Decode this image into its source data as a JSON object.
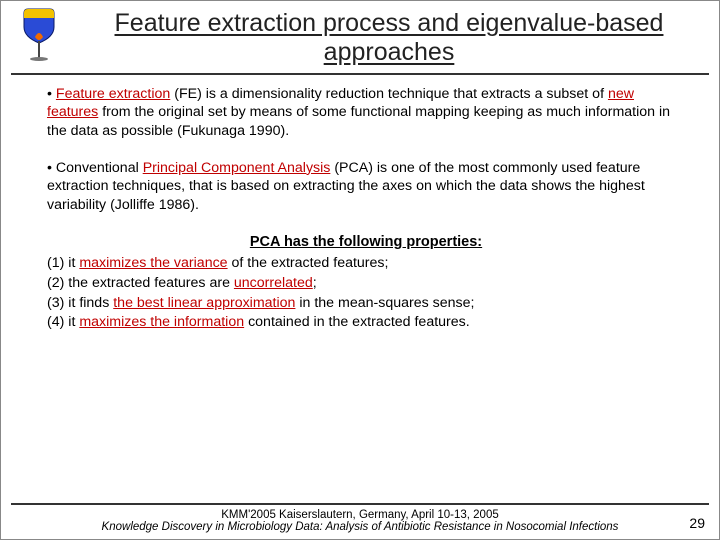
{
  "title": "Feature extraction process and eigenvalue-based approaches",
  "bullets": [
    {
      "pre": "",
      "hl1": "Feature extraction",
      "mid1": " (FE) is a dimensionality reduction technique that extracts a subset of ",
      "hl2": "new features",
      "mid2": " from the original set by means of some functional mapping keeping as much information in the data as possible (Fukunaga 1990)."
    },
    {
      "pre": "Conventional ",
      "hl1": "Principal Component Analysis",
      "mid1": " (PCA) is one of the most commonly used feature extraction techniques, that is based on extracting the axes on which the data shows the highest variability (Jolliffe 1986).",
      "hl2": "",
      "mid2": ""
    }
  ],
  "properties_heading": "PCA has the following properties:",
  "properties": [
    {
      "n": "(1)",
      "pre": " it ",
      "hl": "maximizes the variance",
      "post": " of the extracted features;"
    },
    {
      "n": "(2)",
      "pre": " the extracted features are ",
      "hl": "uncorrelated",
      "post": ";"
    },
    {
      "n": "(3)",
      "pre": " it finds ",
      "hl": "the best linear approximation",
      "post": " in the mean-squares sense;"
    },
    {
      "n": "(4)",
      "pre": " it ",
      "hl": "maximizes the information",
      "post": " contained in the extracted features."
    }
  ],
  "footer": {
    "line1": "KMM'2005 Kaiserslautern, Germany,  April 10-13, 2005",
    "line2": "Knowledge Discovery in Microbiology Data: Analysis of Antibiotic Resistance in Nosocomial Infections"
  },
  "page_number": "29"
}
